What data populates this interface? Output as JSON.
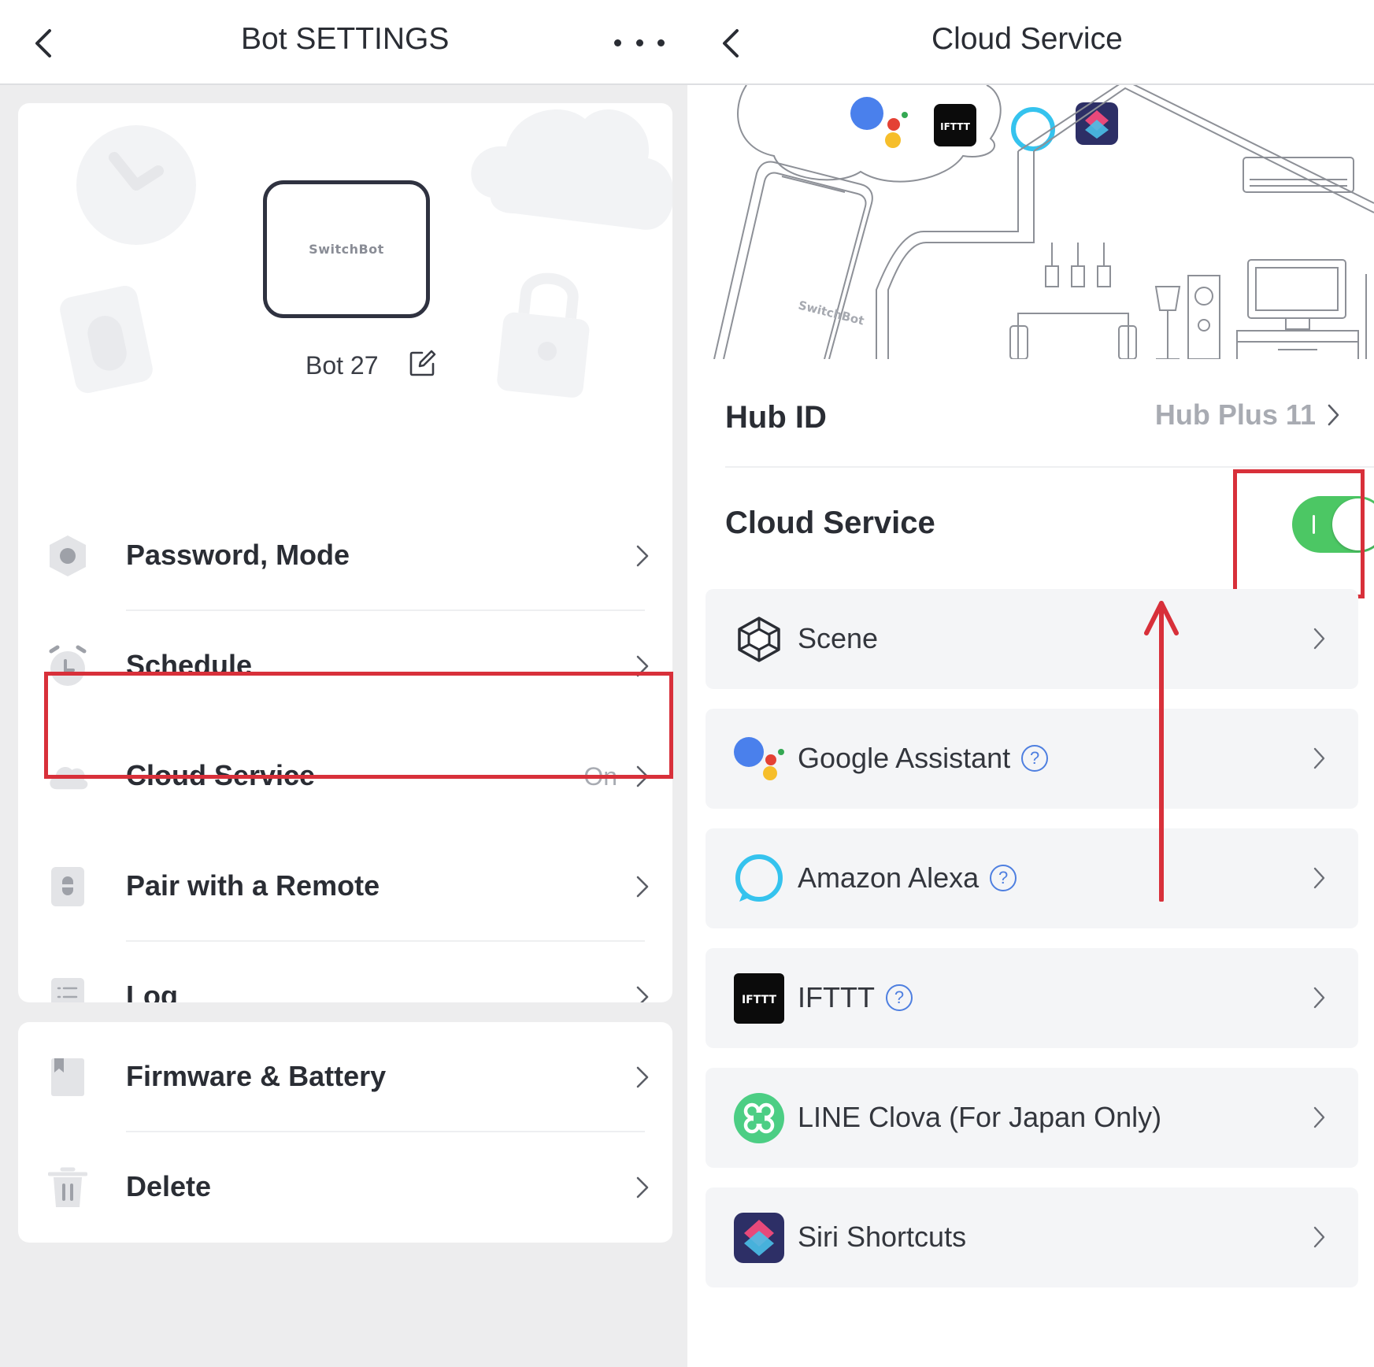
{
  "left": {
    "title": "Bot SETTINGS",
    "device": {
      "logo_text": "SwitchBot",
      "name": "Bot 27"
    },
    "menu": [
      {
        "id": "password",
        "label": "Password, Mode",
        "icon": "shield-dot-icon",
        "value": ""
      },
      {
        "id": "schedule",
        "label": "Schedule",
        "icon": "alarm-clock-icon",
        "value": ""
      },
      {
        "id": "cloud",
        "label": "Cloud Service",
        "icon": "cloud-icon",
        "value": "On"
      },
      {
        "id": "remote",
        "label": "Pair with a Remote",
        "icon": "remote-icon",
        "value": ""
      },
      {
        "id": "log",
        "label": "Log",
        "icon": "list-icon",
        "value": ""
      }
    ],
    "menu2": [
      {
        "id": "firmware",
        "label": "Firmware & Battery",
        "icon": "bookmark-icon"
      },
      {
        "id": "delete",
        "label": "Delete",
        "icon": "trash-icon"
      }
    ]
  },
  "right": {
    "title": "Cloud Service",
    "illustration": {
      "phone_text": "SwitchBot",
      "ifttt_text": "IFTTT"
    },
    "hub": {
      "label": "Hub ID",
      "value": "Hub Plus 11"
    },
    "cloud_service": {
      "label": "Cloud Service",
      "enabled": true
    },
    "services": [
      {
        "id": "scene",
        "label": "Scene",
        "icon": "cube-icon",
        "help": false
      },
      {
        "id": "google",
        "label": "Google Assistant",
        "icon": "google-assistant-icon",
        "help": true
      },
      {
        "id": "alexa",
        "label": "Amazon Alexa",
        "icon": "alexa-icon",
        "help": true
      },
      {
        "id": "ifttt",
        "label": "IFTTT",
        "icon": "ifttt-icon",
        "help": true
      },
      {
        "id": "line",
        "label": "LINE Clova (For Japan Only)",
        "icon": "clova-icon",
        "help": false
      },
      {
        "id": "siri",
        "label": "Siri Shortcuts",
        "icon": "siri-shortcuts-icon",
        "help": false
      }
    ],
    "help_glyph": "?"
  },
  "colors": {
    "highlight": "#d8303a",
    "toggle_on": "#4cc764",
    "help": "#4e7fe0",
    "muted": "#a8abb2"
  }
}
